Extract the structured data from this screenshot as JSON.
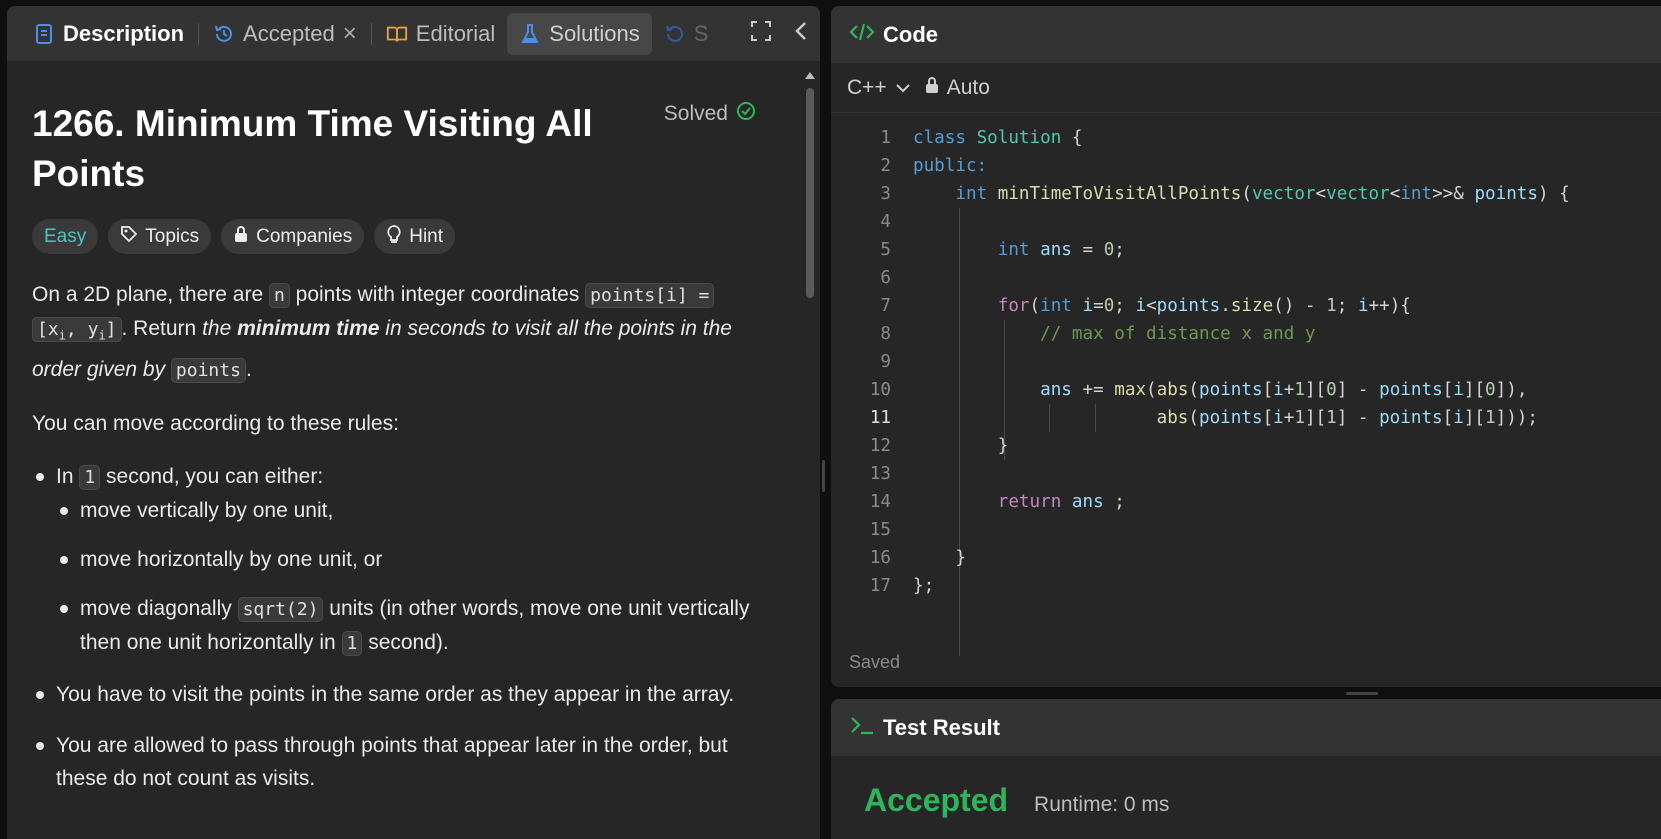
{
  "tabs": {
    "description": "Description",
    "accepted": "Accepted",
    "editorial": "Editorial",
    "solutions": "Solutions",
    "submissions": "S"
  },
  "problem": {
    "title": "1266. Minimum Time Visiting All Points",
    "solved_label": "Solved",
    "tags": {
      "difficulty": "Easy",
      "topics": "Topics",
      "companies": "Companies",
      "hint": "Hint"
    },
    "p1": {
      "t1": "On a 2D plane, there are ",
      "c1": "n",
      "t2": " points with integer coordinates ",
      "c2": "points[i] =",
      "c3a": "[x",
      "c3sub1": "i",
      "c3b": ", y",
      "c3sub2": "i",
      "c3c": "]",
      "t3": ". Return ",
      "i1": "the ",
      "b1": "minimum time",
      "i2": " in seconds to visit all the points in the order given by ",
      "c4": "points",
      "t4": "."
    },
    "p2": "You can move according to these rules:",
    "rules": {
      "r1a": "In ",
      "r1code": "1",
      "r1b": " second, you can either:",
      "s1": "move vertically by one unit,",
      "s2": "move horizontally by one unit, or",
      "s3a": "move diagonally ",
      "s3code": "sqrt(2)",
      "s3b": " units (in other words, move one unit vertically then one unit horizontally in ",
      "s3code2": "1",
      "s3c": " second).",
      "r2": "You have to visit the points in the same order as they appear in the array.",
      "r3": "You are allowed to pass through points that appear later in the order, but these do not count as visits."
    }
  },
  "code_panel": {
    "title": "Code",
    "language": "C++",
    "mode": "Auto",
    "status": "Saved",
    "line_numbers": [
      "1",
      "2",
      "3",
      "4",
      "5",
      "6",
      "7",
      "8",
      "9",
      "10",
      "11",
      "12",
      "13",
      "14",
      "15",
      "16",
      "17"
    ],
    "current_line": "11"
  },
  "result_panel": {
    "title": "Test Result",
    "verdict": "Accepted",
    "runtime": "Runtime: 0 ms"
  },
  "colors": {
    "accent_green": "#2db55d",
    "easy_teal": "#46c6c2",
    "solved_green": "#2db55d",
    "tab_blue": "#4a8fe7"
  }
}
